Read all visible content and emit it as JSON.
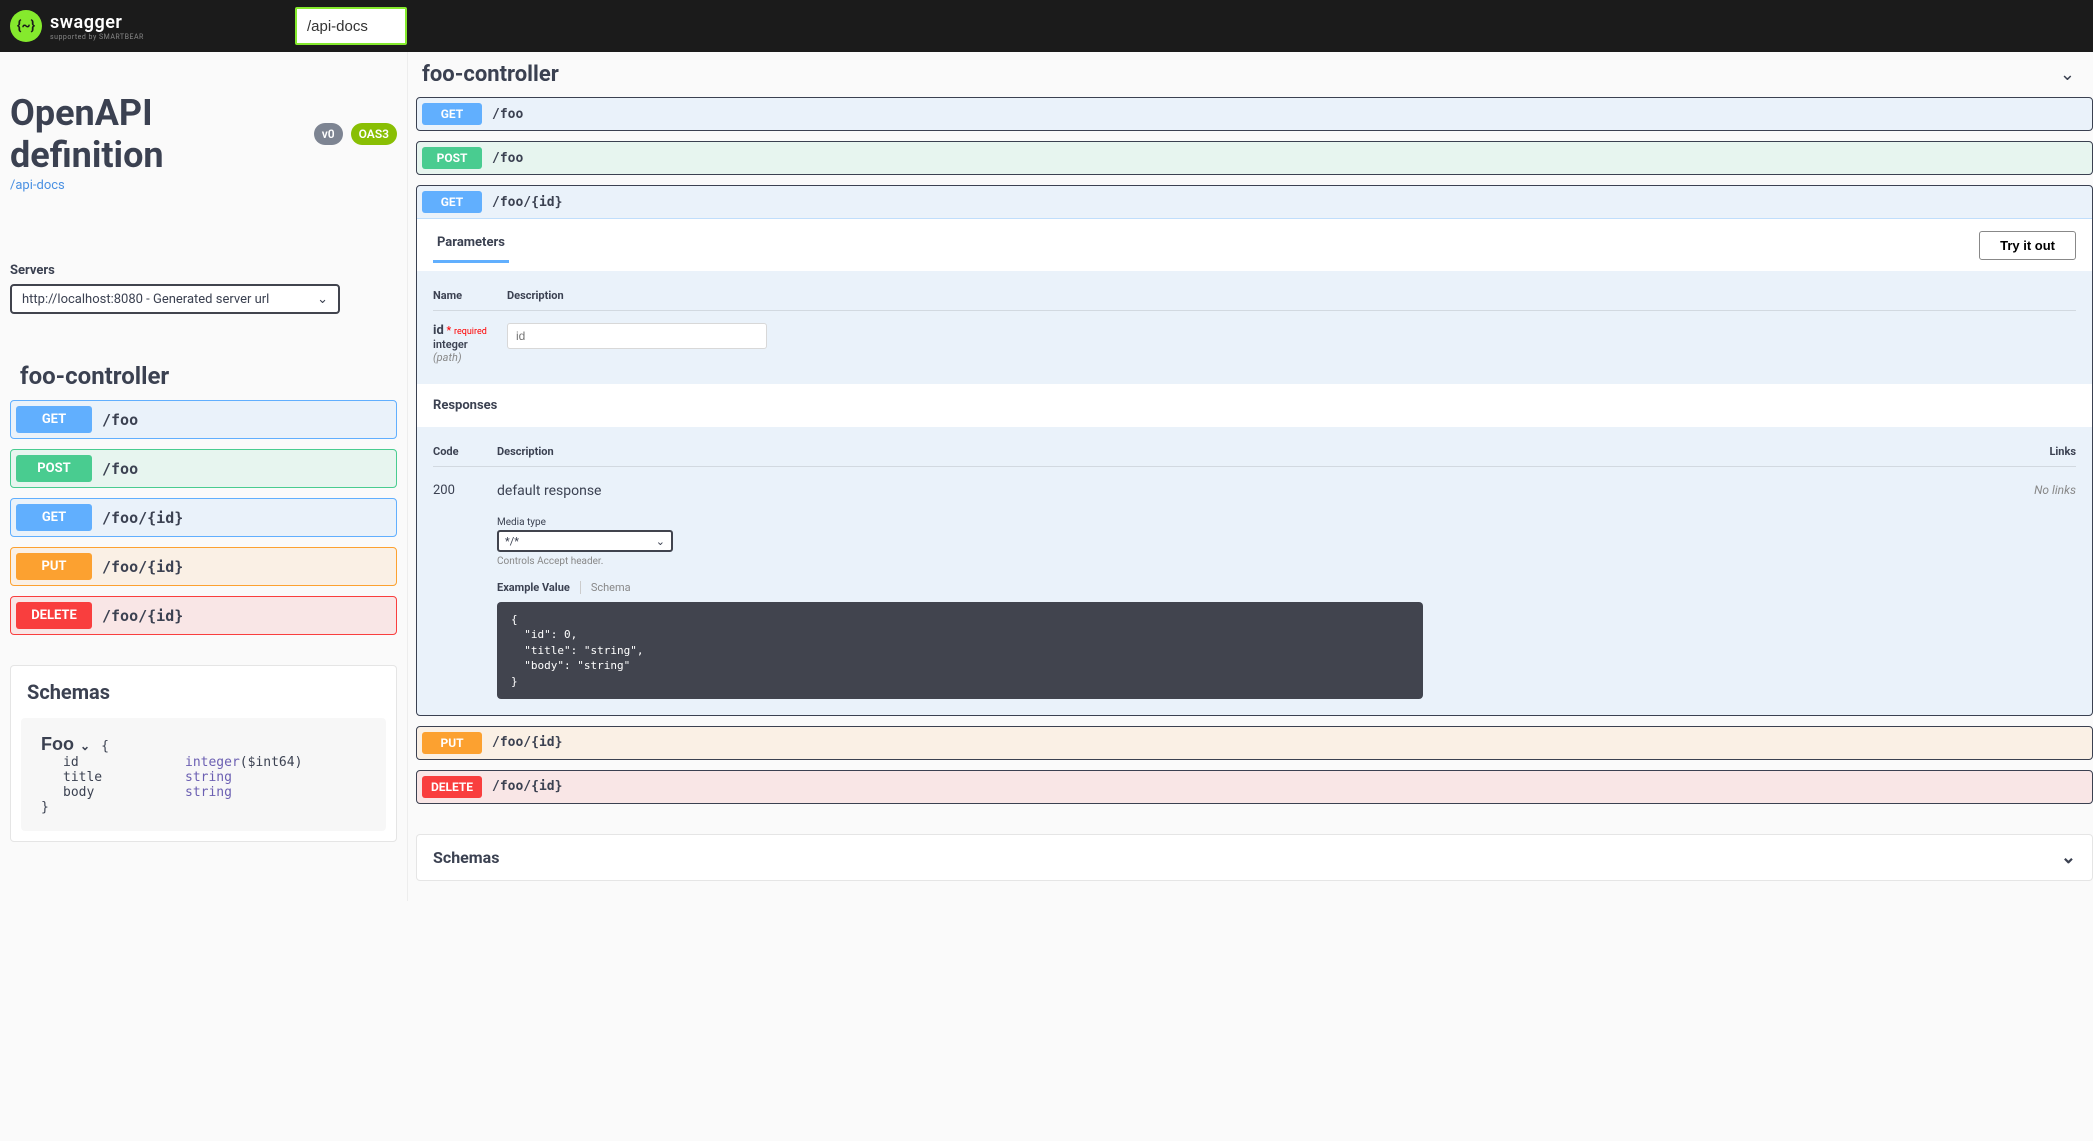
{
  "topbar": {
    "brand": "swagger",
    "sub": "supported by SMARTBEAR",
    "url_value": "/api-docs"
  },
  "api": {
    "title": "OpenAPI definition",
    "version": "v0",
    "oas": "OAS3",
    "docs_link": "/api-docs"
  },
  "servers": {
    "label": "Servers",
    "selected": "http://localhost:8080 - Generated server url"
  },
  "left": {
    "controller": "foo-controller",
    "ops": [
      {
        "method": "GET",
        "path": "/foo",
        "cls": "get"
      },
      {
        "method": "POST",
        "path": "/foo",
        "cls": "post"
      },
      {
        "method": "GET",
        "path": "/foo/{id}",
        "cls": "get"
      },
      {
        "method": "PUT",
        "path": "/foo/{id}",
        "cls": "put"
      },
      {
        "method": "DELETE",
        "path": "/foo/{id}",
        "cls": "delete"
      }
    ],
    "schemas_title": "Schemas",
    "schema": {
      "name": "Foo",
      "props": [
        {
          "name": "id",
          "type": "integer",
          "extra": "($int64)"
        },
        {
          "name": "title",
          "type": "string",
          "extra": ""
        },
        {
          "name": "body",
          "type": "string",
          "extra": ""
        }
      ]
    }
  },
  "right": {
    "controller": "foo-controller",
    "ops": [
      {
        "method": "GET",
        "path": "/foo",
        "cls": "get"
      },
      {
        "method": "POST",
        "path": "/foo",
        "cls": "post"
      },
      {
        "method": "GET",
        "path": "/foo/{id}",
        "cls": "get",
        "expanded": true
      },
      {
        "method": "PUT",
        "path": "/foo/{id}",
        "cls": "put"
      },
      {
        "method": "DELETE",
        "path": "/foo/{id}",
        "cls": "delete"
      }
    ],
    "expanded": {
      "tab_parameters": "Parameters",
      "try_it_out": "Try it out",
      "headers": {
        "name": "Name",
        "desc": "Description"
      },
      "param": {
        "name": "id",
        "required": "required",
        "type": "integer",
        "loc": "(path)",
        "placeholder": "id"
      },
      "responses_title": "Responses",
      "resp_headers": {
        "code": "Code",
        "desc": "Description",
        "links": "Links"
      },
      "resp": {
        "code": "200",
        "desc": "default response",
        "no_links": "No links",
        "media_label": "Media type",
        "media_value": "*/*",
        "accept_note": "Controls Accept header.",
        "tab_example": "Example Value",
        "tab_schema": "Schema",
        "example": "{\n  \"id\": 0,\n  \"title\": \"string\",\n  \"body\": \"string\"\n}"
      }
    },
    "schemas_title": "Schemas"
  }
}
